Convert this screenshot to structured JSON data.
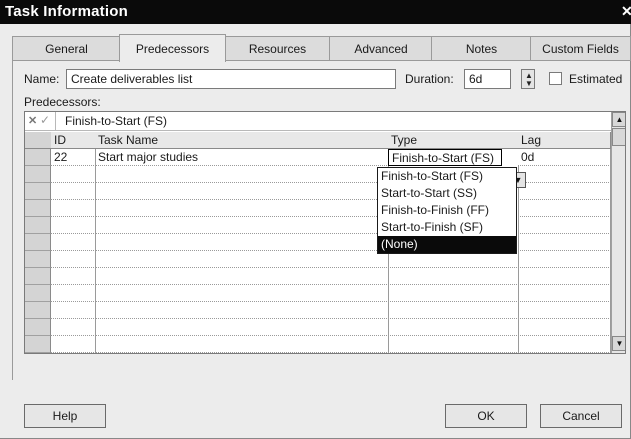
{
  "window": {
    "title": "Task Information"
  },
  "tabs": [
    {
      "label": "General"
    },
    {
      "label": "Predecessors",
      "active": true
    },
    {
      "label": "Resources"
    },
    {
      "label": "Advanced"
    },
    {
      "label": "Notes"
    },
    {
      "label": "Custom Fields"
    }
  ],
  "name_field": {
    "label": "Name:",
    "value": "Create deliverables list"
  },
  "duration_field": {
    "label": "Duration:",
    "value": "6d"
  },
  "estimated": {
    "label": "Estimated",
    "checked": false
  },
  "predecessors_label": "Predecessors:",
  "edit_bar": {
    "value": "Finish-to-Start (FS)"
  },
  "grid": {
    "columns": [
      "ID",
      "Task Name",
      "Type",
      "Lag"
    ],
    "rows": [
      {
        "id": "22",
        "task_name": "Start major studies",
        "type": "Finish-to-Start (FS)",
        "lag": "0d"
      }
    ]
  },
  "type_dropdown": {
    "options": [
      "Finish-to-Start (FS)",
      "Start-to-Start (SS)",
      "Finish-to-Finish (FF)",
      "Start-to-Finish (SF)",
      "(None)"
    ],
    "highlighted": "(None)"
  },
  "buttons": {
    "help": "Help",
    "ok": "OK",
    "cancel": "Cancel"
  },
  "icons": {
    "close": "close-icon",
    "cancel_edit": "x-icon",
    "confirm_edit": "check-icon",
    "spinner": "spinner-arrows-icon",
    "dropdown": "chevron-down-icon",
    "scroll_up": "scroll-up-icon",
    "scroll_down": "scroll-down-icon"
  },
  "colors": {
    "titlebar": "#0a0a0a",
    "highlight": "#0a0a0a",
    "dialog": "#ececec"
  }
}
